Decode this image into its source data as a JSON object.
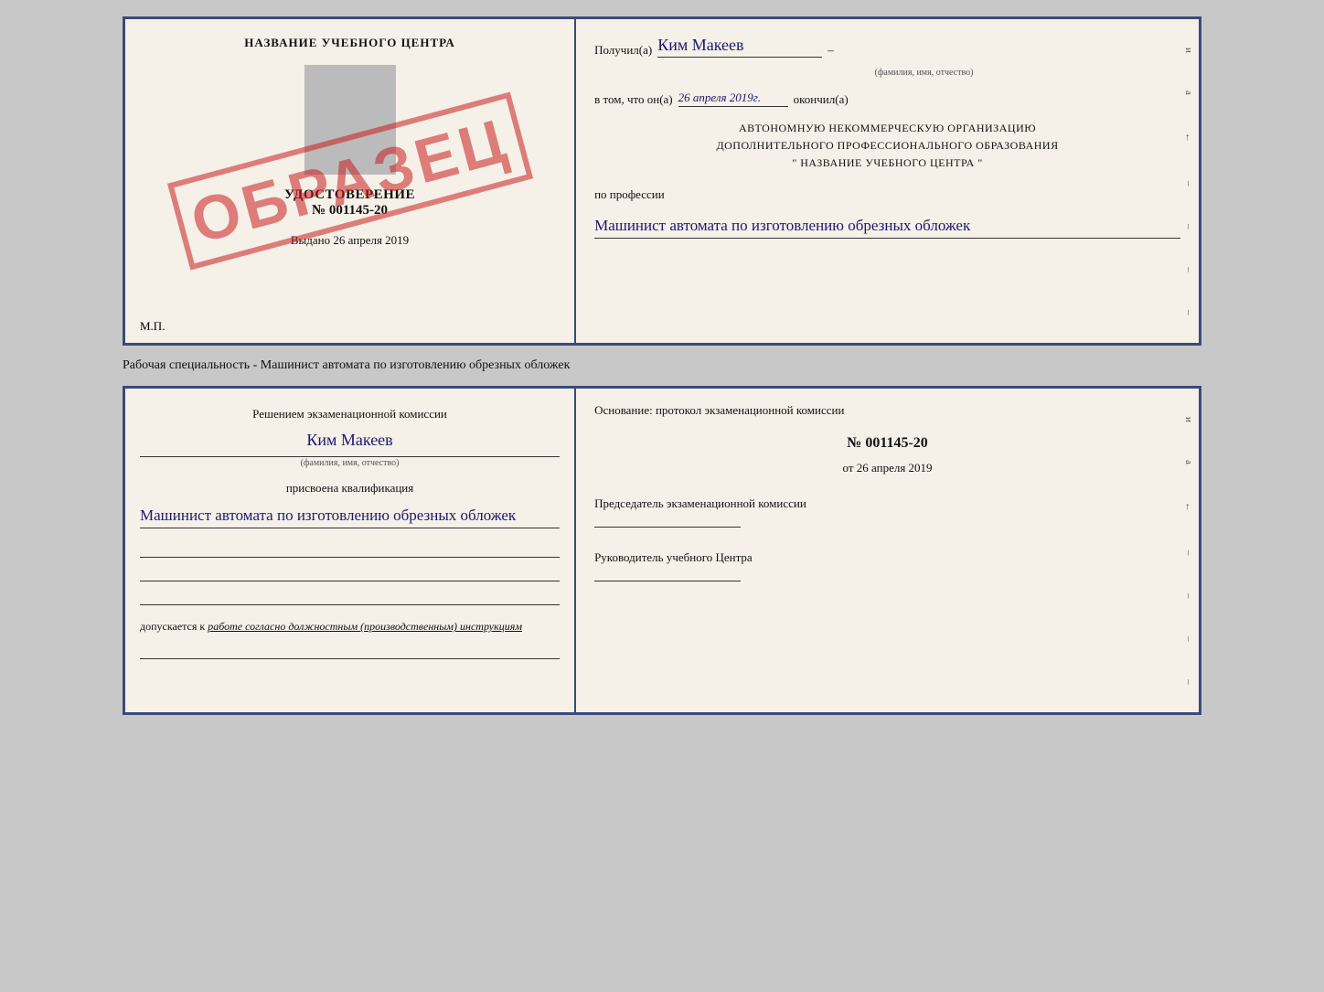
{
  "top_cert": {
    "left": {
      "school_name": "НАЗВАНИЕ УЧЕБНОГО ЦЕНТРА",
      "udostoverenie": "УДОСТОВЕРЕНИЕ",
      "number": "№ 001145-20",
      "vydano_label": "Выдано",
      "vydano_date": "26 апреля 2019",
      "mp": "М.П.",
      "stamp": "ОБРАЗЕЦ"
    },
    "right": {
      "poluchil": "Получил(а)",
      "name": "Ким Макеев",
      "fio_hint": "(фамилия, имя, отчество)",
      "vtom": "в том, что он(а)",
      "date": "26 апреля 2019г.",
      "okonchil": "окончил(а)",
      "org_line1": "АВТОНОМНУЮ НЕКОММЕРЧЕСКУЮ ОРГАНИЗАЦИЮ",
      "org_line2": "ДОПОЛНИТЕЛЬНОГО ПРОФЕССИОНАЛЬНОГО ОБРАЗОВАНИЯ",
      "org_line3": "\"  НАЗВАНИЕ УЧЕБНОГО ЦЕНТРА  \"",
      "po_professii": "по профессии",
      "profession": "Машинист автомата по изготовлению обрезных обложек",
      "margin_chars": [
        "и",
        "а",
        "←",
        "–",
        "–",
        "–",
        "–"
      ]
    }
  },
  "caption": "Рабочая специальность - Машинист автомата по изготовлению обрезных обложек",
  "bottom_cert": {
    "left": {
      "reshen": "Решением экзаменационной комиссии",
      "name": "Ким Макеев",
      "fio_hint": "(фамилия, имя, отчество)",
      "prisvoena": "присвоена квалификация",
      "kvali": "Машинист автомата по изготовлению обрезных обложек",
      "dopuskaetsya_prefix": "допускается к",
      "dopuskaetsya_text": "работе согласно должностным (производственным) инструкциям"
    },
    "right": {
      "osnovanie": "Основание: протокол экзаменационной комиссии",
      "number": "№ 001145-20",
      "ot_label": "от",
      "date": "26 апреля 2019",
      "predsedatel": "Председатель экзаменационной комиссии",
      "rukovoditel": "Руководитель учебного Центра",
      "margin_chars": [
        "и",
        "а",
        "←",
        "–",
        "–",
        "–",
        "–"
      ]
    }
  }
}
